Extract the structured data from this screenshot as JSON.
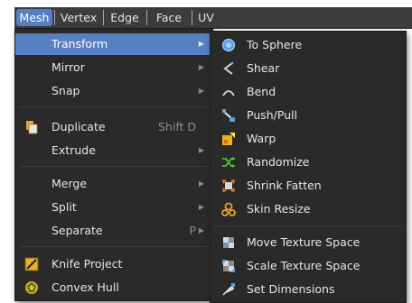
{
  "header": {
    "tabs": [
      {
        "label": "Mesh",
        "active": true
      },
      {
        "label": "Vertex"
      },
      {
        "label": "Edge"
      },
      {
        "label": "Face"
      },
      {
        "label": "UV"
      }
    ]
  },
  "mesh_menu": {
    "items": [
      {
        "label": "Transform",
        "submenu": true,
        "highlighted": true
      },
      {
        "label": "Mirror",
        "submenu": true
      },
      {
        "label": "Snap",
        "submenu": true
      },
      {
        "label": "Duplicate",
        "shortcut": "Shift D",
        "icon": "duplicate-icon"
      },
      {
        "label": "Extrude",
        "submenu": true
      },
      {
        "label": "Merge",
        "submenu": true
      },
      {
        "label": "Split",
        "submenu": true
      },
      {
        "label": "Separate",
        "shortcut": "P",
        "submenu": true
      },
      {
        "label": "Knife Project",
        "icon": "knife-project-icon"
      },
      {
        "label": "Convex Hull",
        "icon": "convex-hull-icon"
      }
    ]
  },
  "transform_submenu": {
    "items": [
      {
        "label": "To Sphere",
        "icon": "to-sphere-icon"
      },
      {
        "label": "Shear",
        "icon": "shear-icon"
      },
      {
        "label": "Bend",
        "icon": "bend-icon"
      },
      {
        "label": "Push/Pull",
        "icon": "push-pull-icon"
      },
      {
        "label": "Warp",
        "icon": "warp-icon"
      },
      {
        "label": "Randomize",
        "icon": "randomize-icon"
      },
      {
        "label": "Shrink Fatten",
        "icon": "shrink-fatten-icon"
      },
      {
        "label": "Skin Resize",
        "icon": "skin-resize-icon"
      },
      {
        "label": "Move Texture Space",
        "icon": "move-texture-space-icon"
      },
      {
        "label": "Scale Texture Space",
        "icon": "scale-texture-space-icon"
      },
      {
        "label": "Set Dimensions",
        "icon": "set-dimensions-icon"
      }
    ]
  },
  "colors": {
    "highlight": "#5680c2",
    "menu_bg": "#2a2a2a",
    "header_bg": "#3c3c3c"
  }
}
